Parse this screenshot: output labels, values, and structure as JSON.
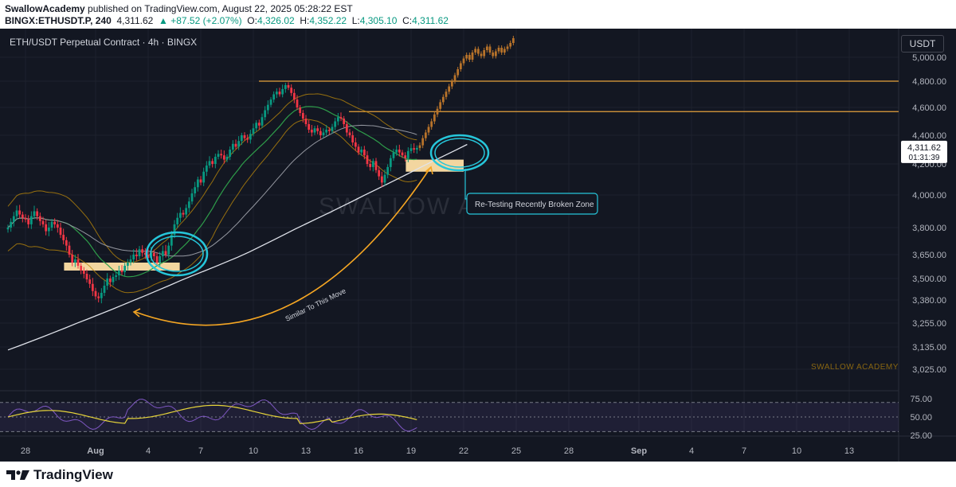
{
  "header": {
    "author": "SwallowAcademy",
    "published_text": " published on TradingView.com, August 22, 2025 05:28:22 EST",
    "symbol": "BINGX:ETHUSDT.P, 240",
    "last": "4,311.62",
    "change": "▲ +87.52 (+2.07%)",
    "o_label": "O:",
    "o_val": "4,326.02",
    "h_label": "H:",
    "h_val": "4,352.22",
    "l_label": "L:",
    "l_val": "4,305.10",
    "c_label": "C:",
    "c_val": "4,311.62"
  },
  "chart_title": "ETH/USDT Perpetual Contract · 4h · BINGX",
  "currency_button": "USDT",
  "price_tag": {
    "price": "4,311.62",
    "countdown": "01:31:39"
  },
  "annotations": {
    "retest_label": "Re-Testing Recently Broken Zone",
    "similar_label": "Similar To This Move",
    "watermark_center": "SWALLOW ACADEMY",
    "watermark_corner": "SWALLOW ACADEMY"
  },
  "footer": {
    "brand": "TradingView"
  },
  "colors": {
    "background": "#131722",
    "up": "#089981",
    "down": "#f23645",
    "projection": "#b8732a",
    "resistance": "#e6a23c",
    "zone": "#ffe0a6",
    "circle": "#26c6da",
    "rsi_line": "#7e57c2",
    "rsi_ma": "#e6d43a"
  },
  "chart_data": {
    "type": "candlestick",
    "title": "ETH/USDT Perpetual Contract · 4h · BINGX",
    "y_ticks": [
      "5,000.00",
      "4,800.00",
      "4,600.00",
      "4,400.00",
      "4,200.00",
      "4,000.00",
      "3,800.00",
      "3,650.00",
      "3,500.00",
      "3,380.00",
      "3,255.00",
      "3,135.00",
      "3,025.00"
    ],
    "y_tick_values": [
      5000,
      4800,
      4600,
      4400,
      4200,
      4000,
      3800,
      3650,
      3500,
      3380,
      3255,
      3135,
      3025
    ],
    "x_ticks": [
      "28",
      "Aug",
      "4",
      "7",
      "10",
      "13",
      "16",
      "19",
      "22",
      "25",
      "28",
      "Sep",
      "4",
      "7",
      "10",
      "13"
    ],
    "x_tick_days": [
      -4,
      0,
      3,
      6,
      9,
      12,
      15,
      18,
      21,
      24,
      27,
      31,
      34,
      37,
      40,
      43
    ],
    "days_per_candle": 0.16667,
    "resistance_levels": [
      4800,
      4570
    ],
    "zones": [
      {
        "day_from": -1.8,
        "day_to": 4.8,
        "low": 3550,
        "high": 3600
      },
      {
        "day_from": 17.7,
        "day_to": 21.0,
        "low": 4150,
        "high": 4230
      }
    ],
    "candles_close": [
      3800,
      3835,
      3870,
      3905,
      3880,
      3860,
      3850,
      3820,
      3870,
      3900,
      3870,
      3840,
      3820,
      3780,
      3800,
      3835,
      3820,
      3800,
      3760,
      3730,
      3700,
      3650,
      3600,
      3620,
      3580,
      3550,
      3530,
      3495,
      3470,
      3430,
      3400,
      3390,
      3420,
      3460,
      3500,
      3480,
      3510,
      3520,
      3550,
      3540,
      3580,
      3600,
      3620,
      3650,
      3640,
      3680,
      3660,
      3650,
      3630,
      3660,
      3640,
      3600,
      3640,
      3670,
      3650,
      3700,
      3760,
      3820,
      3860,
      3890,
      3880,
      3920,
      3960,
      4010,
      4050,
      4100,
      4080,
      4150,
      4190,
      4220,
      4200,
      4250,
      4270,
      4260,
      4230,
      4250,
      4300,
      4340,
      4320,
      4360,
      4400,
      4380,
      4370,
      4410,
      4450,
      4490,
      4470,
      4530,
      4580,
      4620,
      4660,
      4700,
      4720,
      4700,
      4740,
      4770,
      4750,
      4710,
      4660,
      4600,
      4560,
      4520,
      4480,
      4440,
      4420,
      4450,
      4430,
      4400,
      4420,
      4440,
      4430,
      4460,
      4500,
      4530,
      4520,
      4480,
      4420,
      4400,
      4350,
      4320,
      4280,
      4300,
      4260,
      4200,
      4180,
      4220,
      4160,
      4120,
      4080,
      4130,
      4180,
      4240,
      4280,
      4300,
      4280,
      4260,
      4240,
      4290,
      4310,
      4300,
      4311.62
    ],
    "projection_close": [
      4330,
      4380,
      4420,
      4460,
      4500,
      4550,
      4590,
      4640,
      4680,
      4720,
      4760,
      4800,
      4850,
      4900,
      4950,
      4990,
      5020,
      4980,
      5040,
      5070,
      5030,
      5010,
      5060,
      5090,
      5040,
      5010,
      5050,
      5080,
      5040,
      5070,
      5090,
      5120,
      5160
    ],
    "rsi": {
      "y_ticks": [
        "75.00",
        "50.00",
        "25.00"
      ],
      "y_tick_values": [
        75,
        50,
        25
      ],
      "band": [
        30,
        70
      ]
    }
  }
}
